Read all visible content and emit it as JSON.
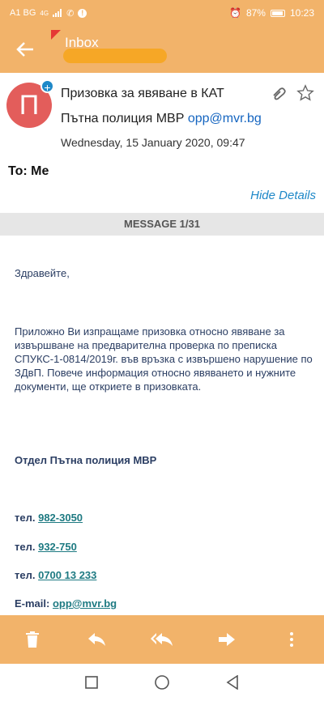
{
  "status_bar": {
    "carrier": "A1 BG",
    "network": "4G",
    "battery": "87%",
    "time": "10:23"
  },
  "app_bar": {
    "title": "Inbox"
  },
  "header": {
    "avatar_letter": "П",
    "subject": "Призовка за явяване в КАТ",
    "from_name": "Пътна полиция МВР",
    "from_email": "opp@mvr.bg",
    "date": "Wednesday, 15 January 2020, 09:47",
    "to": "To: Me",
    "hide_details": "Hide Details"
  },
  "message_counter": "MESSAGE 1/31",
  "body": {
    "greeting": "Здравейте,",
    "paragraph": "Приложно Ви изпращаме призовка относно явяване за извършване на предварителна проверка по преписка СПУКС-1-0814/2019г. във връзка с извършено нарушение по ЗДвП. Повече информация относно явяването и нужните документи, ще откриете в призовката.",
    "department": "Отдел Пътна полиция МВР",
    "tel_label": "тел.",
    "tel1": "982-3050",
    "tel2": "932-750",
    "tel3": "0700 13 233",
    "email_label": "E-mail:",
    "email": "opp@mvr.bg"
  },
  "colors": {
    "accent": "#f2b36a",
    "link": "#1e88c8",
    "avatar": "#e35d5b"
  }
}
